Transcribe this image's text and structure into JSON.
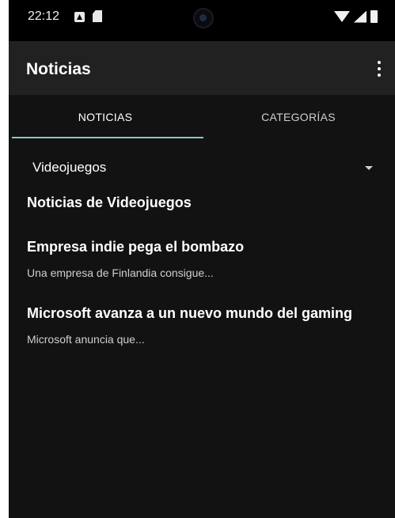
{
  "status_bar": {
    "time": "22:12",
    "icons": [
      "notification-a-icon",
      "sd-card-icon",
      "camera-icon",
      "wifi-icon",
      "cell-signal-icon",
      "battery-icon"
    ]
  },
  "app_bar": {
    "title": "Noticias",
    "menu_icon": "more-vert-icon"
  },
  "tabs": [
    {
      "label": "NOTICIAS",
      "selected": true
    },
    {
      "label": "CATEGORÍAS",
      "selected": false
    }
  ],
  "spinner": {
    "selected": "Videojuegos",
    "arrow_icon": "dropdown-arrow-icon"
  },
  "section_title": "Noticias de Videojuegos",
  "news": [
    {
      "title": "Empresa indie pega el bombazo",
      "description": "Una empresa de Finlandia consigue..."
    },
    {
      "title": "Microsoft avanza a un nuevo mundo del gaming",
      "description": "Microsoft anuncia que..."
    }
  ],
  "colors": {
    "background": "#121212",
    "app_bar": "#212121",
    "tab_indicator": "#80cbc4",
    "text_primary": "#ffffff",
    "text_secondary": "#cfcfcf"
  }
}
